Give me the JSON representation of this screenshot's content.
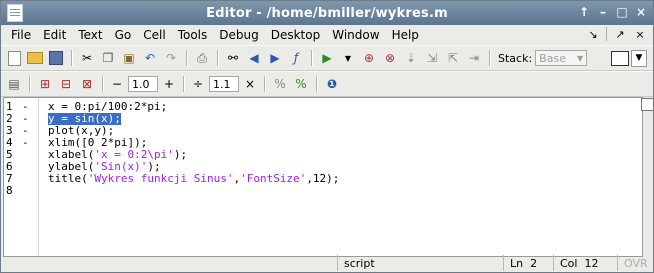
{
  "window": {
    "title": "Editor - /home/bmiller/wykres.m",
    "controls": [
      "↑",
      "–",
      "□",
      "×"
    ]
  },
  "menu": {
    "items": [
      "File",
      "Edit",
      "Text",
      "Go",
      "Cell",
      "Tools",
      "Debug",
      "Desktop",
      "Window",
      "Help"
    ],
    "right_icons": [
      "↘",
      "↗",
      "×"
    ]
  },
  "toolbar1": {
    "stack_label": "Stack:",
    "stack_value": "Base"
  },
  "toolbar2": {
    "minus": "−",
    "value1": "1.0",
    "plus": "+",
    "divide": "÷",
    "value2": "1.1",
    "times": "×"
  },
  "code": {
    "lines": [
      {
        "num": "1",
        "dash": "-",
        "text": "x = 0:pi/100:2*pi;"
      },
      {
        "num": "2",
        "dash": "-",
        "text": "y = sin(x);"
      },
      {
        "num": "3",
        "dash": "-",
        "text": "plot(x,y);"
      },
      {
        "num": "4",
        "dash": "-",
        "text": "xlim([0 2*pi]);"
      },
      {
        "num": "5",
        "dash": "",
        "text": "xlabel('x = 0:2\\pi');"
      },
      {
        "num": "6",
        "dash": "",
        "text": "ylabel('Sin(x)');"
      },
      {
        "num": "7",
        "dash": "",
        "text": "title('Wykres funkcji Sinus','FontSize',12);"
      },
      {
        "num": "8",
        "dash": "",
        "text": ""
      }
    ]
  },
  "status": {
    "mode": "script",
    "ln_label": "Ln",
    "ln_value": "2",
    "col_label": "Col",
    "col_value": "12",
    "ovr": "OVR"
  },
  "colors": {
    "title_bar": "#5c7690",
    "selection": "#3a6ec6",
    "string": "#a020f0"
  }
}
